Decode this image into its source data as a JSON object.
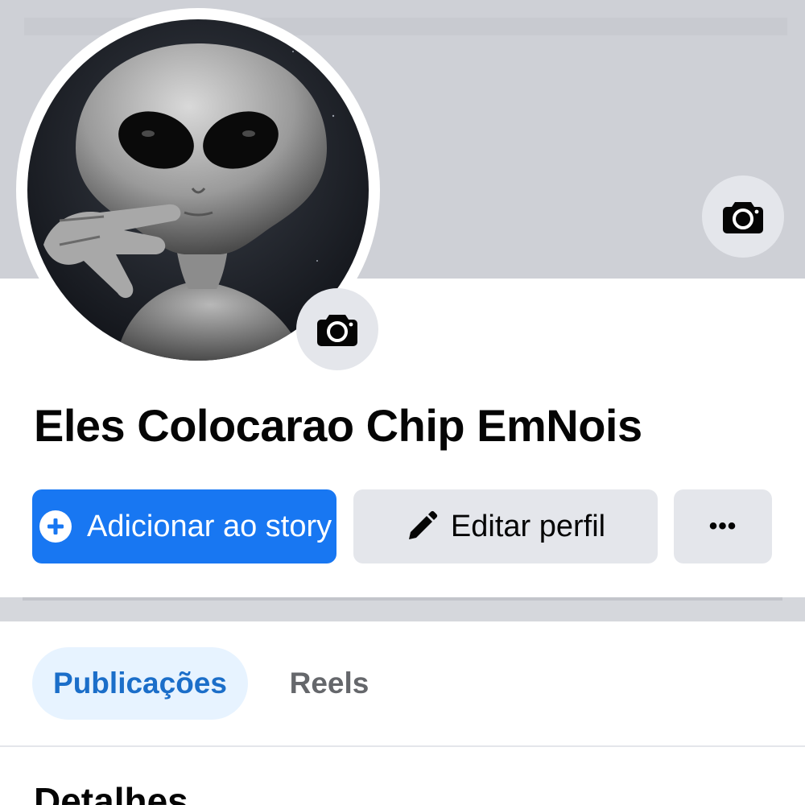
{
  "profile": {
    "name": "Eles Colocarao Chip EmNois",
    "avatar_alt": "alien-avatar"
  },
  "cover": {
    "camera_icon": "camera-icon"
  },
  "actions": {
    "add_story_label": "Adicionar ao story",
    "add_story_icon": "plus-circle-icon",
    "edit_profile_label": "Editar perfil",
    "edit_profile_icon": "pencil-icon",
    "more_label": "•••",
    "accent_color": "#1877f2"
  },
  "tabs": [
    {
      "label": "Publicações",
      "active": true
    },
    {
      "label": "Reels",
      "active": false
    }
  ],
  "details": {
    "title": "Detalhes"
  }
}
